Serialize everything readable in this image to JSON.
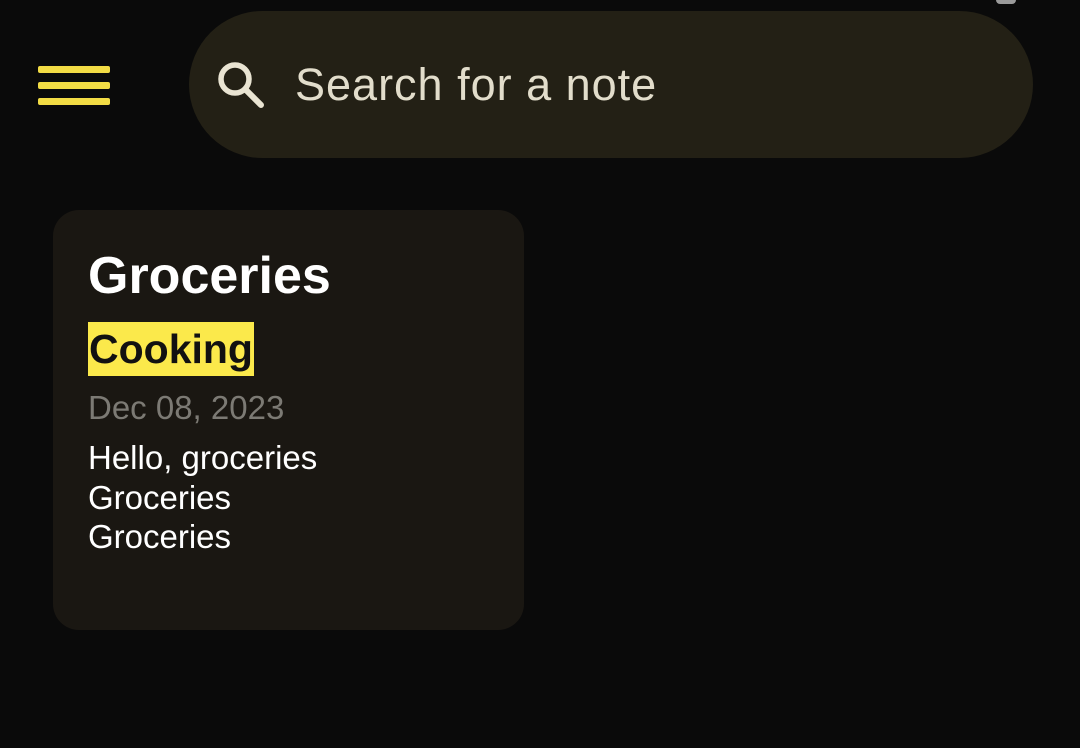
{
  "header": {
    "menu_icon": "menu-icon",
    "search": {
      "icon": "search-icon",
      "placeholder": "Search for a note",
      "value": ""
    }
  },
  "notes": [
    {
      "title": "Groceries",
      "tag": "Cooking",
      "date": "Dec 08, 2023",
      "body_lines": [
        "Hello, groceries",
        "Groceries",
        "Groceries"
      ]
    }
  ],
  "colors": {
    "background": "#0a0a0a",
    "accent": "#f2dc45",
    "tag_highlight": "#fbe94b",
    "search_bar": "#232015",
    "card": "#1a1712"
  }
}
